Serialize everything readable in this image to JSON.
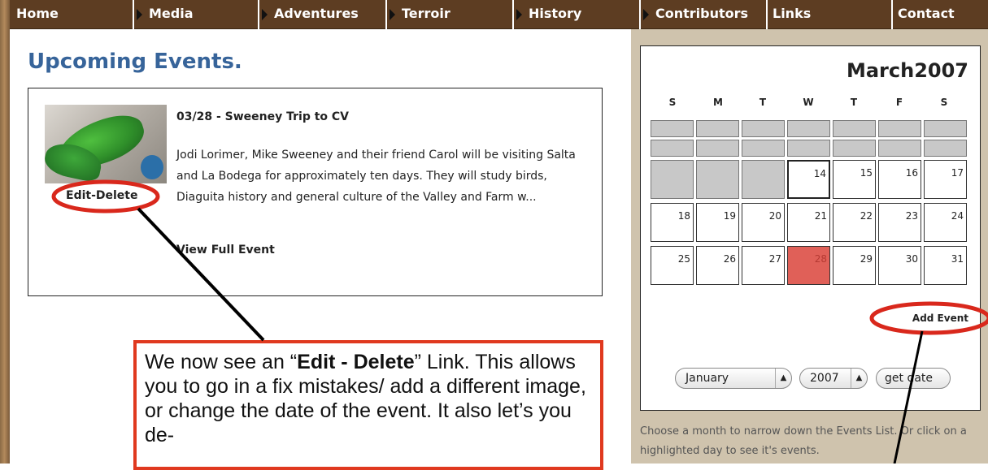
{
  "nav": {
    "items": [
      "Home",
      "Media",
      "Adventures",
      "Terroir",
      "History",
      "Contributors",
      "Links",
      "Contact"
    ]
  },
  "page": {
    "title": "Upcoming Events."
  },
  "event": {
    "title": "03/28 - Sweeney Trip to CV",
    "description": "Jodi Lorimer, Mike Sweeney and their friend Carol will be visiting Salta and La Bodega for approximately ten days. They will study birds, Diaguita history and general culture of the Valley and Farm w...",
    "edit_delete_label": "Edit-Delete",
    "view_full_label": "View Full Event"
  },
  "calendar": {
    "month_label": "March2007",
    "weekdays": [
      "S",
      "M",
      "T",
      "W",
      "T",
      "F",
      "S"
    ],
    "days": [
      "14",
      "15",
      "16",
      "17",
      "18",
      "19",
      "20",
      "21",
      "22",
      "23",
      "24",
      "25",
      "26",
      "27",
      "28",
      "29",
      "30",
      "31"
    ],
    "today": "14",
    "highlighted_day": "28",
    "highlight_color": "#e06058",
    "add_event_label": "Add Event",
    "month_select": "January",
    "year_select": "2007",
    "get_date_label": "get date"
  },
  "sidebar": {
    "help_text": "Choose a month to narrow down the Events List. Or click on a highlighted day to see it's events."
  },
  "annotation": {
    "text_before": "We now see an “",
    "bold": "Edit - Delete",
    "text_after": "” Link. This allows you to go in a fix mistakes/ add a different image, or change the date of the event.  It also let’s you de-",
    "border_color": "#e0391f"
  }
}
